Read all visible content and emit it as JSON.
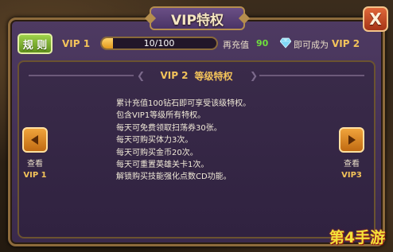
{
  "window": {
    "title": "VIP特权",
    "close_label": "X"
  },
  "status_bar": {
    "rules_label": "规 则",
    "current_vip": "VIP 1",
    "progress_text": "10/100",
    "progress_fraction": 0.1,
    "recharge_label": "再充值",
    "recharge_amount": "90",
    "diamond_icon": "diamond-icon",
    "become_label": "即可成为",
    "next_vip": "VIP 2"
  },
  "details": {
    "header_level": "VIP 2",
    "header_title": "等级特权",
    "benefits": [
      "累计充值100钻石即可享受该级特权。",
      "包含VIP1等级所有特权。",
      "每天可免费领取扫荡券30张。",
      "每天可购买体力3次。",
      "每天可购买金币20次。",
      "每天可重置英雄关卡1次。",
      "解锁购买技能强化点数CD功能。"
    ]
  },
  "navigation": {
    "prev_icon": "arrow-left-icon",
    "prev_view_label": "查看",
    "prev_level": "VIP 1",
    "next_icon": "arrow-right-icon",
    "next_view_label": "查看",
    "next_level": "VIP3"
  },
  "watermark": {
    "text": "第4手游"
  },
  "colors": {
    "panel": "#4e3a62",
    "gold_text": "#f3c35a",
    "green_amount": "#6fe03c",
    "close_button": "#c2461f",
    "rules_button": "#7fb234",
    "nav_button": "#e08a26"
  }
}
